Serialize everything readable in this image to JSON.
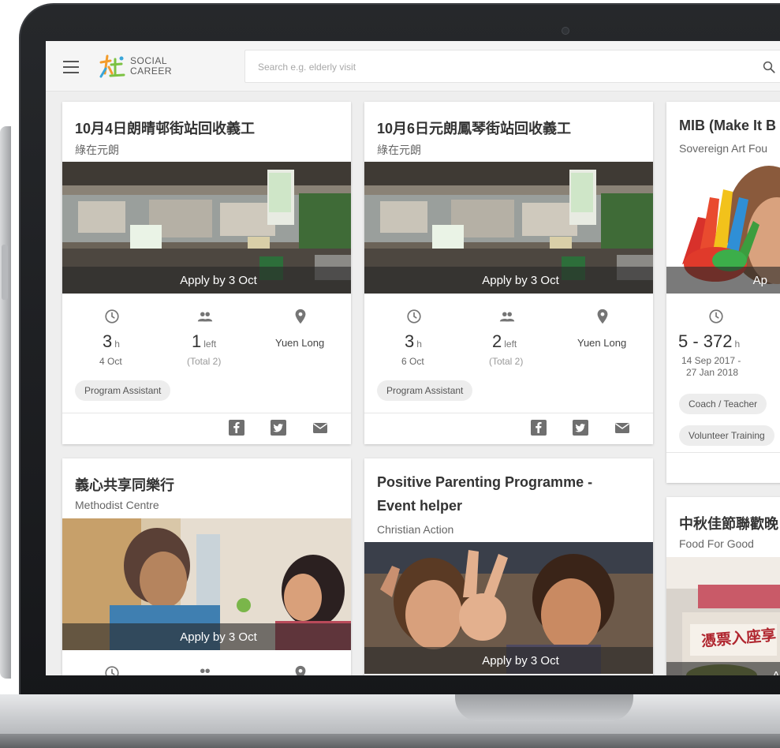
{
  "search": {
    "placeholder": "Search e.g. elderly visit"
  },
  "logo": {
    "line1": "SOCIAL",
    "line2": "CAREER"
  },
  "colors": {
    "logo_orange": "#f39c2b",
    "logo_green": "#7cc242",
    "logo_blue": "#3aa6d9",
    "icon_grey": "#757575"
  },
  "cards": [
    {
      "title": "10月4日朗晴邨街站回收義工",
      "org": "綠在元朗",
      "apply": "Apply by 3 Oct",
      "hours": "3",
      "hours_unit": "h",
      "date": "4 Oct",
      "left": "1",
      "left_unit": "left",
      "total": "(Total 2)",
      "location": "Yuen Long",
      "tags": [
        "Program Assistant"
      ]
    },
    {
      "title": "10月6日元朗鳳琴街站回收義工",
      "org": "綠在元朗",
      "apply": "Apply by 3 Oct",
      "hours": "3",
      "hours_unit": "h",
      "date": "6 Oct",
      "left": "2",
      "left_unit": "left",
      "total": "(Total 2)",
      "location": "Yuen Long",
      "tags": [
        "Program Assistant"
      ]
    },
    {
      "title": "MIB (Make It B",
      "org": "Sovereign Art Fou",
      "apply": "Ap",
      "hours": "5 - 372",
      "hours_unit": "h",
      "date_line1": "14 Sep 2017 -",
      "date_line2": "27 Jan 2018",
      "tags": [
        "Coach / Teacher",
        "Volunteer Training"
      ]
    },
    {
      "title": "義心共享同樂行",
      "org": "Methodist Centre",
      "apply": "Apply by 3 Oct"
    },
    {
      "title_line1": "Positive Parenting Programme -",
      "title_line2": "Event helper",
      "org": "Christian Action",
      "apply": "Apply by 3 Oct"
    },
    {
      "title": "中秋佳節聯歡晚",
      "org": "Food For Good",
      "photo_text": "憑票入座享",
      "apply": "A"
    }
  ]
}
